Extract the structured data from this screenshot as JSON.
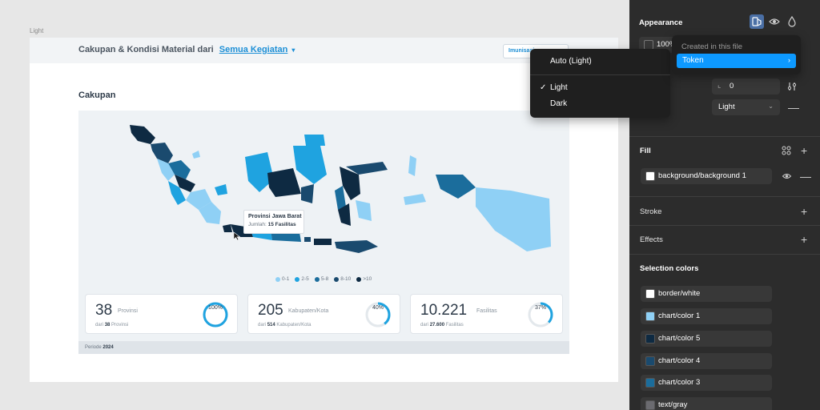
{
  "canvas": {
    "frame_label": "Light",
    "header": {
      "title": "Cakupan & Kondisi Material dari",
      "filter_link": "Semua Kegiatan",
      "chip": "Imunisasi"
    },
    "section_title": "Cakupan",
    "tooltip": {
      "title": "Provinsi Jawa Barat",
      "label": "Jumlah:",
      "value": "15 Fasilitas"
    },
    "legend": [
      {
        "label": "0-1",
        "color": "#8fd0f5"
      },
      {
        "label": "2-5",
        "color": "#1fa3e0"
      },
      {
        "label": "5-8",
        "color": "#1b6d9c"
      },
      {
        "label": "8-10",
        "color": "#1a4a6e"
      },
      {
        "label": ">10",
        "color": "#0e2a42"
      }
    ],
    "stats": [
      {
        "value": "38",
        "unit": "Provinsi",
        "sub_prefix": "dari",
        "sub_value": "38",
        "sub_unit": "Provinsi",
        "percent_label": "100%",
        "percent": 100
      },
      {
        "value": "205",
        "unit": "Kabupaten/Kota",
        "sub_prefix": "dari",
        "sub_value": "514",
        "sub_unit": "Kabupaten/Kota",
        "percent_label": "40%",
        "percent": 40
      },
      {
        "value": "10.221",
        "unit": "Fasilitas",
        "sub_prefix": "dari",
        "sub_value": "27.600",
        "sub_unit": "Fasilitas",
        "percent_label": "37%",
        "percent": 37
      }
    ],
    "footer_label": "Periode",
    "footer_value": "2024"
  },
  "appearance_menu": {
    "items": [
      "Auto (Light)",
      "Light",
      "Dark"
    ],
    "checked": "Light",
    "check_glyph": "✓"
  },
  "token_menu": {
    "header": "Created in this file",
    "item": "Token",
    "chevron": "›"
  },
  "panel": {
    "appearance": {
      "title": "Appearance",
      "opacity": "100%",
      "corner_value": "0",
      "mode_select": "Light"
    },
    "fill": {
      "title": "Fill",
      "item": {
        "name": "background/background 1",
        "color": "#ffffff"
      }
    },
    "stroke": {
      "title": "Stroke"
    },
    "effects": {
      "title": "Effects"
    },
    "selection_colors": {
      "title": "Selection colors",
      "items": [
        {
          "name": "border/white",
          "color": "#ffffff"
        },
        {
          "name": "chart/color 1",
          "color": "#8fd0f5"
        },
        {
          "name": "chart/color 5",
          "color": "#0e2a42"
        },
        {
          "name": "chart/color 4",
          "color": "#1a4a6e"
        },
        {
          "name": "chart/color 3",
          "color": "#1b6d9c"
        },
        {
          "name": "text/gray",
          "color": "#6b6b70"
        }
      ]
    }
  }
}
